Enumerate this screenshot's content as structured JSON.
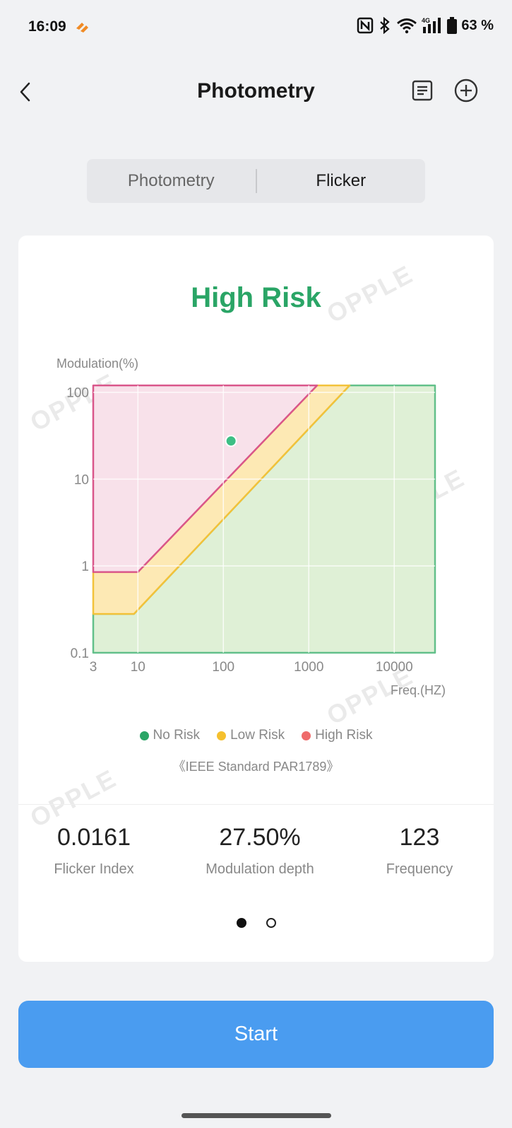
{
  "status_bar": {
    "time": "16:09",
    "battery": "63 %",
    "icons": [
      "app-notification-icon",
      "nfc-icon",
      "bluetooth-icon",
      "wifi-icon",
      "signal-4g-icon",
      "battery-icon"
    ]
  },
  "header": {
    "title": "Photometry",
    "icons": [
      "back-icon",
      "list-icon",
      "add-circle-icon"
    ]
  },
  "tabs": [
    {
      "label": "Photometry",
      "active": false
    },
    {
      "label": "Flicker",
      "active": true
    }
  ],
  "card": {
    "risk_label": "High Risk",
    "risk_color": "#2aa566",
    "watermark_text": "OPPLE",
    "legend": [
      {
        "label": "No Risk",
        "color": "#2aa566"
      },
      {
        "label": "Low Risk",
        "color": "#f5c02e"
      },
      {
        "label": "High Risk",
        "color": "#ef6b6b"
      }
    ],
    "standard_note": "《IEEE Standard PAR1789》",
    "stats": [
      {
        "value": "0.0161",
        "label": "Flicker Index"
      },
      {
        "value": "27.50%",
        "label": "Modulation depth"
      },
      {
        "value": "123",
        "label": "Frequency"
      }
    ],
    "pager": {
      "pages": 2,
      "current": 1
    }
  },
  "chart_data": {
    "type": "area",
    "ylabel": "Modulation(%)",
    "xlabel": "Freq.(HZ)",
    "x_scale": "log",
    "y_scale": "log",
    "x_ticks": [
      "3",
      "10",
      "100",
      "1000",
      "10000"
    ],
    "y_ticks": [
      "100",
      "10",
      "1",
      "0.1"
    ],
    "xlim": [
      3,
      30000
    ],
    "ylim": [
      0.1,
      120
    ],
    "regions": [
      {
        "name": "High Risk",
        "color": "#ef6b6b",
        "fill": "#f8e1ea",
        "stroke": "#d9568a",
        "polygon": [
          [
            3,
            0.85
          ],
          [
            10,
            0.85
          ],
          [
            1250,
            120
          ],
          [
            3,
            120
          ]
        ]
      },
      {
        "name": "Low Risk",
        "color": "#f5c02e",
        "fill": "#fde9b4",
        "stroke": "#f2c23a",
        "polygon": [
          [
            3,
            0.28
          ],
          [
            9,
            0.28
          ],
          [
            3000,
            120
          ],
          [
            1250,
            120
          ],
          [
            10,
            0.85
          ],
          [
            3,
            0.85
          ]
        ]
      },
      {
        "name": "No Risk",
        "color": "#2aa566",
        "fill": "#dff0d6",
        "stroke": "#62c08a",
        "polygon": [
          [
            3,
            0.1
          ],
          [
            30000,
            0.1
          ],
          [
            30000,
            120
          ],
          [
            3000,
            120
          ],
          [
            9,
            0.28
          ],
          [
            3,
            0.28
          ]
        ]
      }
    ],
    "measurement": {
      "x": 123,
      "y": 27.5,
      "color": "#3dbf85"
    },
    "grid": true
  },
  "actions": {
    "start_label": "Start"
  }
}
